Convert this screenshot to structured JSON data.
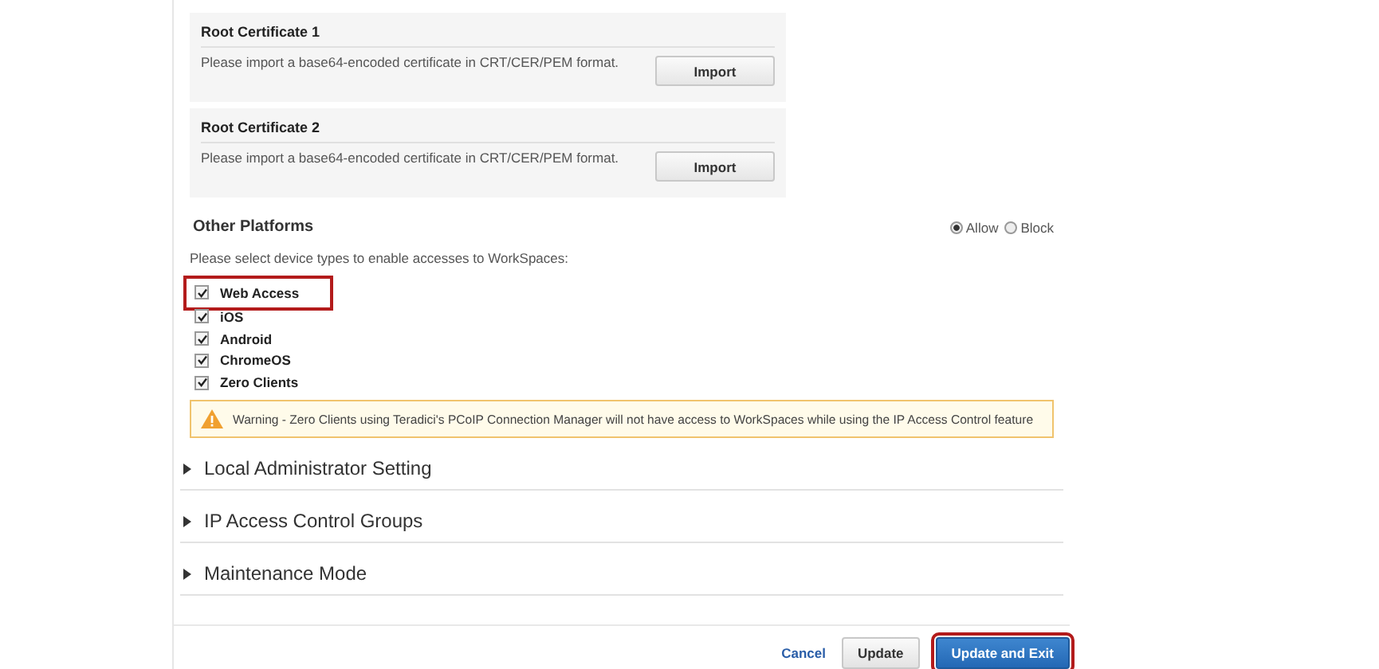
{
  "certificates": [
    {
      "title": "Root Certificate 1",
      "hint": "Please import a base64-encoded certificate in CRT/CER/PEM format.",
      "button": "Import"
    },
    {
      "title": "Root Certificate 2",
      "hint": "Please import a base64-encoded certificate in CRT/CER/PEM format.",
      "button": "Import"
    }
  ],
  "other_platforms": {
    "title": "Other Platforms",
    "options": [
      {
        "label": "Allow",
        "selected": true
      },
      {
        "label": "Block",
        "selected": false
      }
    ],
    "instruction": "Please select device types to enable accesses to WorkSpaces:",
    "devices": [
      {
        "label": "Web Access",
        "checked": true,
        "highlighted": true
      },
      {
        "label": "iOS",
        "checked": true,
        "highlighted": false
      },
      {
        "label": "Android",
        "checked": true,
        "highlighted": false
      },
      {
        "label": "ChromeOS",
        "checked": true,
        "highlighted": false
      },
      {
        "label": "Zero Clients",
        "checked": true,
        "highlighted": false
      }
    ],
    "warning": "Warning - Zero Clients using Teradici's PCoIP Connection Manager will not have access to WorkSpaces while using the IP Access Control feature"
  },
  "sections": [
    {
      "title": "Local Administrator Setting",
      "expanded": false
    },
    {
      "title": "IP Access Control Groups",
      "expanded": false
    },
    {
      "title": "Maintenance Mode",
      "expanded": false
    }
  ],
  "footer": {
    "cancel": "Cancel",
    "buttons": [
      {
        "label": "Update",
        "kind": "secondary",
        "highlighted": false
      },
      {
        "label": "Update and Exit",
        "kind": "primary",
        "highlighted": true
      }
    ]
  }
}
